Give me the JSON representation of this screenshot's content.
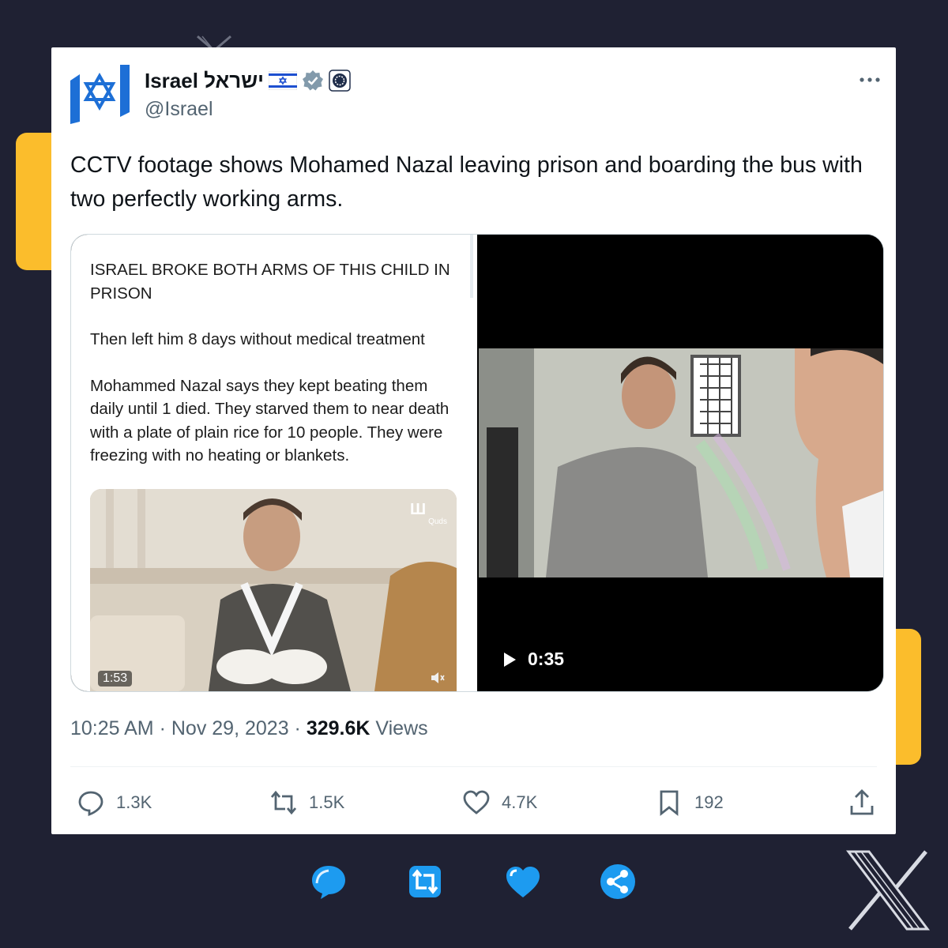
{
  "colors": {
    "background": "#1f2133",
    "accent": "#fbbd2c",
    "card": "#ffffff",
    "brand_blue": "#1d9bf0",
    "text_secondary": "#536471"
  },
  "account": {
    "name": "Israel ישראל",
    "handle": "@Israel",
    "badges": [
      "israel-flag-icon",
      "verified-badge-icon",
      "government-affiliate-icon"
    ]
  },
  "tweet": {
    "text": "CCTV footage shows Mohamed Nazal leaving prison and boarding the bus with two perfectly working arms."
  },
  "quoted_post": {
    "headline": "ISRAEL BROKE BOTH ARMS OF THIS CHILD IN PRISON",
    "line2": "Then left him 8 days without medical treatment",
    "line3": "Mohammed Nazal says they kept beating them daily until 1 died. They starved them to near death with a plate of plain rice for 10 people. They were freezing with no heating or blankets.",
    "video_duration": "1:53",
    "watermark": "Quds"
  },
  "video": {
    "duration": "0:35"
  },
  "meta": {
    "time": "10:25 AM",
    "date": "Nov 29, 2023",
    "sep1": "·",
    "sep2": "·",
    "views_count": "329.6K",
    "views_label": "Views"
  },
  "actions": {
    "replies": "1.3K",
    "reposts": "1.5K",
    "likes": "4.7K",
    "bookmarks": "192"
  },
  "bottom_icons": [
    "comment-icon",
    "repost-icon",
    "heart-icon",
    "share-icon"
  ]
}
